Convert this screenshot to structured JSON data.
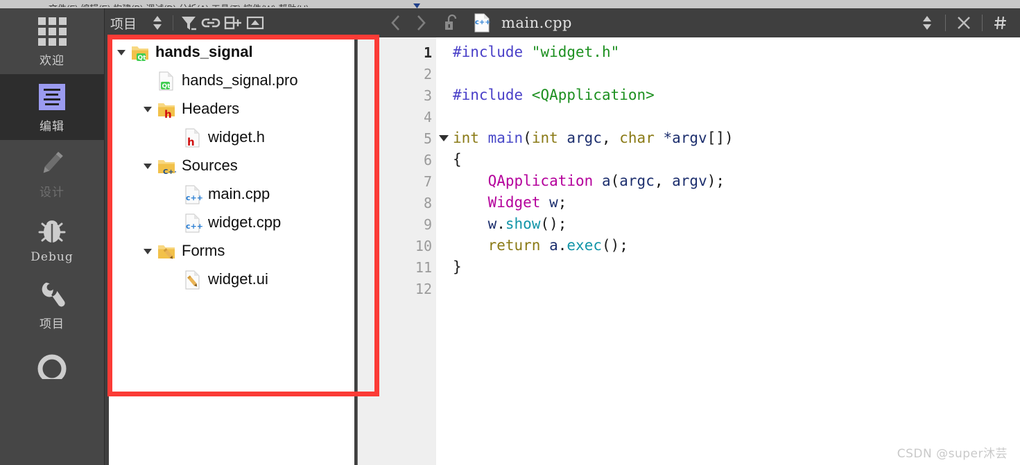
{
  "menubar": {
    "ghost_text": "文件(F)   编辑(E)   构建(B)   调试(D)   分析(A)   工具(T)   控件(W)   帮助(H)"
  },
  "mode_sidebar": {
    "items": [
      {
        "label": "欢迎",
        "icon": "grid-icon",
        "state": "normal",
        "latin": false
      },
      {
        "label": "编辑",
        "icon": "edit-icon",
        "state": "selected",
        "latin": false
      },
      {
        "label": "设计",
        "icon": "pencil-icon",
        "state": "disabled",
        "latin": false
      },
      {
        "label": "Debug",
        "icon": "bug-icon",
        "state": "normal",
        "latin": true
      },
      {
        "label": "项目",
        "icon": "wrench-icon",
        "state": "normal",
        "latin": false
      }
    ],
    "partial_item": {
      "label": "",
      "icon": "help-circle-icon"
    }
  },
  "project_panel": {
    "title": "项目",
    "toolbar": [
      {
        "name": "view-selector-spinner",
        "icon": "up-down-arrows-icon"
      },
      {
        "name": "filter-button",
        "icon": "filter-icon"
      },
      {
        "name": "sync-with-editor-button",
        "icon": "link-icon"
      },
      {
        "name": "split-button",
        "icon": "split-icon"
      },
      {
        "name": "collapse-panel-button",
        "icon": "collapse-icon"
      }
    ],
    "tree": [
      {
        "label": "hands_signal",
        "indent": 0,
        "arrow": "down",
        "icon": "qt-folder-icon",
        "bold": true
      },
      {
        "label": "hands_signal.pro",
        "indent": 1,
        "arrow": "none",
        "icon": "qt-file-icon",
        "bold": false
      },
      {
        "label": "Headers",
        "indent": 1,
        "arrow": "down",
        "icon": "h-folder-icon",
        "bold": false
      },
      {
        "label": "widget.h",
        "indent": 2,
        "arrow": "none",
        "icon": "h-file-icon",
        "bold": false
      },
      {
        "label": "Sources",
        "indent": 1,
        "arrow": "down",
        "icon": "cpp-folder-icon",
        "bold": false
      },
      {
        "label": "main.cpp",
        "indent": 2,
        "arrow": "none",
        "icon": "cpp-file-icon",
        "bold": false
      },
      {
        "label": "widget.cpp",
        "indent": 2,
        "arrow": "none",
        "icon": "cpp-file-icon",
        "bold": false
      },
      {
        "label": "Forms",
        "indent": 1,
        "arrow": "down",
        "icon": "ui-folder-icon",
        "bold": false
      },
      {
        "label": "widget.ui",
        "indent": 2,
        "arrow": "none",
        "icon": "ui-file-icon",
        "bold": false
      }
    ]
  },
  "editor": {
    "toolbar": {
      "back_icon": "chevron-left-icon",
      "forward_icon": "chevron-right-icon",
      "lock_icon": "unlocked-padlock-icon",
      "file_icon": "cpp-file-icon",
      "filename": "main.cpp",
      "spinner_icon": "up-down-arrows-icon",
      "close_icon": "close-x-icon",
      "split_icon": "hash-split-icon"
    },
    "line_numbers": [
      "1",
      "2",
      "3",
      "4",
      "5",
      "6",
      "7",
      "8",
      "9",
      "10",
      "11",
      "12"
    ],
    "current_line": 1,
    "fold_marker_line": 5,
    "lines": [
      {
        "n": 1,
        "tokens": [
          {
            "t": "#include ",
            "c": "tk-pre"
          },
          {
            "t": "\"widget.h\"",
            "c": "tk-str"
          }
        ]
      },
      {
        "n": 2,
        "tokens": []
      },
      {
        "n": 3,
        "tokens": [
          {
            "t": "#include ",
            "c": "tk-pre"
          },
          {
            "t": "<QApplication>",
            "c": "tk-str"
          }
        ]
      },
      {
        "n": 4,
        "tokens": []
      },
      {
        "n": 5,
        "tokens": [
          {
            "t": "int ",
            "c": "tk-type"
          },
          {
            "t": "main",
            "c": "tk-func"
          },
          {
            "t": "(",
            "c": "tk-plain"
          },
          {
            "t": "int ",
            "c": "tk-type"
          },
          {
            "t": "argc",
            "c": "tk-var"
          },
          {
            "t": ", ",
            "c": "tk-plain"
          },
          {
            "t": "char ",
            "c": "tk-type"
          },
          {
            "t": "*argv",
            "c": "tk-var"
          },
          {
            "t": "[])",
            "c": "tk-plain"
          }
        ]
      },
      {
        "n": 6,
        "tokens": [
          {
            "t": "{",
            "c": "tk-plain"
          }
        ]
      },
      {
        "n": 7,
        "tokens": [
          {
            "t": "    ",
            "c": "tk-plain"
          },
          {
            "t": "QApplication",
            "c": "tk-class"
          },
          {
            "t": " ",
            "c": "tk-plain"
          },
          {
            "t": "a",
            "c": "tk-var"
          },
          {
            "t": "(",
            "c": "tk-plain"
          },
          {
            "t": "argc",
            "c": "tk-var"
          },
          {
            "t": ", ",
            "c": "tk-plain"
          },
          {
            "t": "argv",
            "c": "tk-var"
          },
          {
            "t": ");",
            "c": "tk-plain"
          }
        ]
      },
      {
        "n": 8,
        "tokens": [
          {
            "t": "    ",
            "c": "tk-plain"
          },
          {
            "t": "Widget",
            "c": "tk-class"
          },
          {
            "t": " ",
            "c": "tk-plain"
          },
          {
            "t": "w",
            "c": "tk-var"
          },
          {
            "t": ";",
            "c": "tk-plain"
          }
        ]
      },
      {
        "n": 9,
        "tokens": [
          {
            "t": "    ",
            "c": "tk-plain"
          },
          {
            "t": "w",
            "c": "tk-var"
          },
          {
            "t": ".",
            "c": "tk-plain"
          },
          {
            "t": "show",
            "c": "tk-method"
          },
          {
            "t": "();",
            "c": "tk-plain"
          }
        ]
      },
      {
        "n": 10,
        "tokens": [
          {
            "t": "    ",
            "c": "tk-plain"
          },
          {
            "t": "return ",
            "c": "tk-kw"
          },
          {
            "t": "a",
            "c": "tk-var"
          },
          {
            "t": ".",
            "c": "tk-plain"
          },
          {
            "t": "exec",
            "c": "tk-method"
          },
          {
            "t": "();",
            "c": "tk-plain"
          }
        ]
      },
      {
        "n": 11,
        "tokens": [
          {
            "t": "}",
            "c": "tk-plain"
          }
        ]
      },
      {
        "n": 12,
        "tokens": []
      }
    ]
  },
  "annotation": {
    "name": "red-highlight-rectangle",
    "color": "#fb3b36"
  },
  "watermark": {
    "text": "CSDN @super沐芸"
  },
  "colors": {
    "chrome_dark": "#3f3f3f",
    "sidebar": "#464646",
    "sidebar_selected": "#2d2d2d",
    "accent_blue": "#9b9bf0",
    "annotation_red": "#fb3b36",
    "qt_green": "#41cd52",
    "folder_yellow": "#f2c14a"
  }
}
